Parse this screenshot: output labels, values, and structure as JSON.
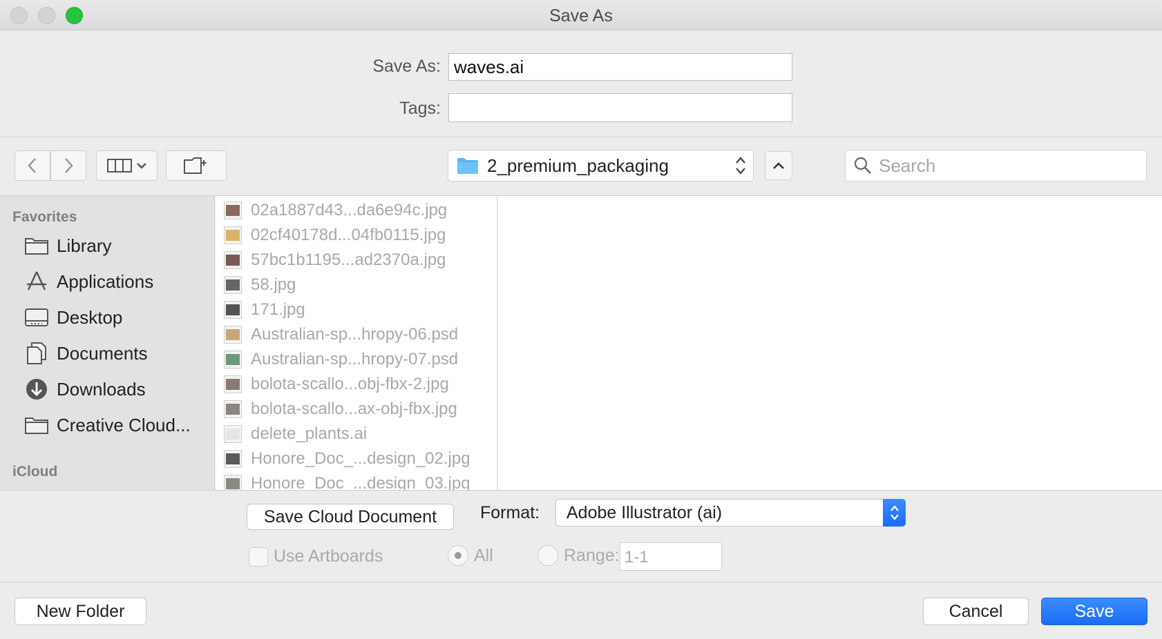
{
  "window": {
    "title": "Save As"
  },
  "form": {
    "save_as_label": "Save As:",
    "save_as_value": "waves.ai",
    "tags_label": "Tags:",
    "tags_value": ""
  },
  "toolbar": {
    "location": "2_premium_packaging",
    "search_placeholder": "Search"
  },
  "sidebar": {
    "favorites_header": "Favorites",
    "items": [
      {
        "label": "Library",
        "icon": "folder-icon"
      },
      {
        "label": "Applications",
        "icon": "applications-icon"
      },
      {
        "label": "Desktop",
        "icon": "desktop-icon"
      },
      {
        "label": "Documents",
        "icon": "documents-icon"
      },
      {
        "label": "Downloads",
        "icon": "downloads-icon"
      },
      {
        "label": "Creative Cloud...",
        "icon": "folder-icon"
      }
    ],
    "icloud_header": "iCloud"
  },
  "files": [
    {
      "name": "02a1887d43...da6e94c.jpg",
      "thumb_color": "#8a6a60"
    },
    {
      "name": "02cf40178d...04fb0115.jpg",
      "thumb_color": "#d8b36a"
    },
    {
      "name": "57bc1b1195...ad2370a.jpg",
      "thumb_color": "#7a5a55"
    },
    {
      "name": "58.jpg",
      "thumb_color": "#666666"
    },
    {
      "name": "171.jpg",
      "thumb_color": "#555555"
    },
    {
      "name": "Australian-sp...hropy-06.psd",
      "thumb_color": "#c9a77a"
    },
    {
      "name": "Australian-sp...hropy-07.psd",
      "thumb_color": "#6b9a7a"
    },
    {
      "name": "bolota-scallo...obj-fbx-2.jpg",
      "thumb_color": "#8a7a70"
    },
    {
      "name": "bolota-scallo...ax-obj-fbx.jpg",
      "thumb_color": "#8d8580"
    },
    {
      "name": "delete_plants.ai",
      "thumb_color": "#e6e6e6"
    },
    {
      "name": "Honore_Doc_...design_02.jpg",
      "thumb_color": "#5a5a5a"
    },
    {
      "name": "Honore_Doc_...design_03.jpg",
      "thumb_color": "#8a8a80"
    }
  ],
  "options": {
    "save_cloud_document": "Save Cloud Document",
    "format_label": "Format:",
    "format_value": "Adobe Illustrator (ai)",
    "use_artboards": "Use Artboards",
    "all": "All",
    "range": "Range:",
    "range_value": "1-1"
  },
  "footer": {
    "new_folder": "New Folder",
    "cancel": "Cancel",
    "save": "Save"
  },
  "colors": {
    "accent": "#1a6ef5",
    "folder": "#5ab4f0"
  }
}
